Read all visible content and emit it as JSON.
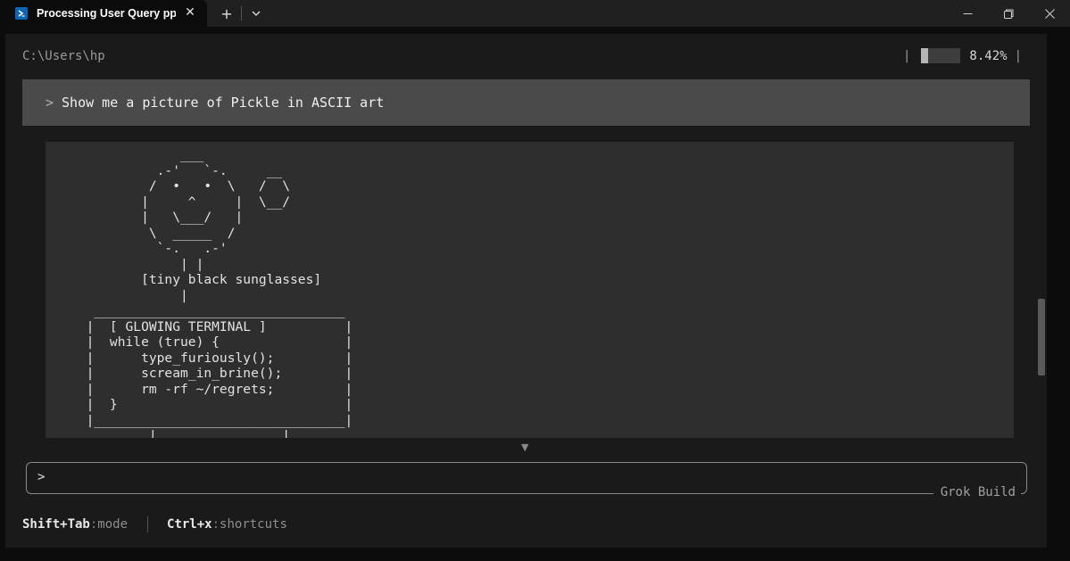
{
  "window": {
    "tab_title": "Processing User Query ppppp",
    "tab_icon": "powershell-icon",
    "new_tab_label": "+",
    "dropdown_icon": "chevron-down-icon"
  },
  "terminal": {
    "cwd": "C:\\Users\\hp",
    "usage_percent": "8.42%",
    "usage_fraction": 0.0842,
    "user_prompt_caret": ">",
    "user_prompt": "Show me a picture of Pickle in ASCII art",
    "ascii_art": "              ___\n           .-'   `-.     __\n          /  •   •  \\   /  \\\n         |     ^     |  \\__/\n         |   \\___/   |\n          \\  _____  /\n           `-.   .-'\n              | |\n         [tiny black sunglasses]\n              |\n   ________________________________\n  |  [ GLOWING TERMINAL ]          |\n  |  while (true) {                |\n  |      type_furiously();         |\n  |      scream_in_brine();        |\n  |      rm -rf ~/regrets;         |\n  |  }                             |\n  |________________________________|\n          |                |",
    "input_caret": ">",
    "input_label": "Grok Build"
  },
  "hints": [
    {
      "key": "Shift+Tab",
      "sep": ":",
      "desc": "mode"
    },
    {
      "key": "Ctrl+x",
      "sep": ":",
      "desc": "shortcuts"
    }
  ],
  "colors": {
    "background": "#0c0c0c",
    "panel": "#1a1a1a",
    "prompt_bar": "#4a4a4a",
    "output_box": "#2e2e2e"
  }
}
